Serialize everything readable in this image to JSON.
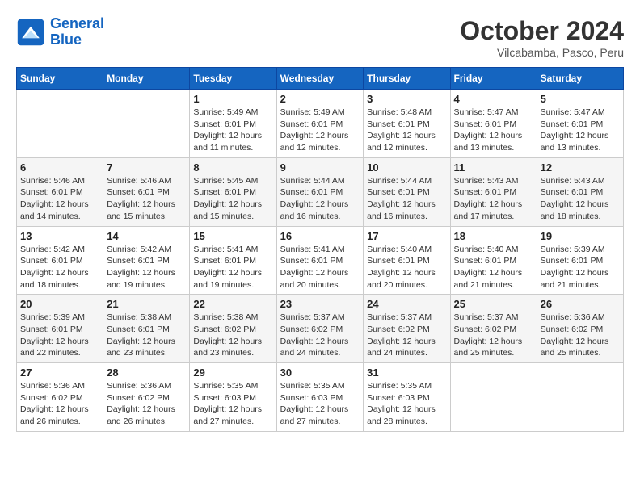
{
  "logo": {
    "line1": "General",
    "line2": "Blue"
  },
  "title": "October 2024",
  "subtitle": "Vilcabamba, Pasco, Peru",
  "weekdays": [
    "Sunday",
    "Monday",
    "Tuesday",
    "Wednesday",
    "Thursday",
    "Friday",
    "Saturday"
  ],
  "weeks": [
    [
      {
        "day": "",
        "info": ""
      },
      {
        "day": "",
        "info": ""
      },
      {
        "day": "1",
        "info": "Sunrise: 5:49 AM\nSunset: 6:01 PM\nDaylight: 12 hours\nand 11 minutes."
      },
      {
        "day": "2",
        "info": "Sunrise: 5:49 AM\nSunset: 6:01 PM\nDaylight: 12 hours\nand 12 minutes."
      },
      {
        "day": "3",
        "info": "Sunrise: 5:48 AM\nSunset: 6:01 PM\nDaylight: 12 hours\nand 12 minutes."
      },
      {
        "day": "4",
        "info": "Sunrise: 5:47 AM\nSunset: 6:01 PM\nDaylight: 12 hours\nand 13 minutes."
      },
      {
        "day": "5",
        "info": "Sunrise: 5:47 AM\nSunset: 6:01 PM\nDaylight: 12 hours\nand 13 minutes."
      }
    ],
    [
      {
        "day": "6",
        "info": "Sunrise: 5:46 AM\nSunset: 6:01 PM\nDaylight: 12 hours\nand 14 minutes."
      },
      {
        "day": "7",
        "info": "Sunrise: 5:46 AM\nSunset: 6:01 PM\nDaylight: 12 hours\nand 15 minutes."
      },
      {
        "day": "8",
        "info": "Sunrise: 5:45 AM\nSunset: 6:01 PM\nDaylight: 12 hours\nand 15 minutes."
      },
      {
        "day": "9",
        "info": "Sunrise: 5:44 AM\nSunset: 6:01 PM\nDaylight: 12 hours\nand 16 minutes."
      },
      {
        "day": "10",
        "info": "Sunrise: 5:44 AM\nSunset: 6:01 PM\nDaylight: 12 hours\nand 16 minutes."
      },
      {
        "day": "11",
        "info": "Sunrise: 5:43 AM\nSunset: 6:01 PM\nDaylight: 12 hours\nand 17 minutes."
      },
      {
        "day": "12",
        "info": "Sunrise: 5:43 AM\nSunset: 6:01 PM\nDaylight: 12 hours\nand 18 minutes."
      }
    ],
    [
      {
        "day": "13",
        "info": "Sunrise: 5:42 AM\nSunset: 6:01 PM\nDaylight: 12 hours\nand 18 minutes."
      },
      {
        "day": "14",
        "info": "Sunrise: 5:42 AM\nSunset: 6:01 PM\nDaylight: 12 hours\nand 19 minutes."
      },
      {
        "day": "15",
        "info": "Sunrise: 5:41 AM\nSunset: 6:01 PM\nDaylight: 12 hours\nand 19 minutes."
      },
      {
        "day": "16",
        "info": "Sunrise: 5:41 AM\nSunset: 6:01 PM\nDaylight: 12 hours\nand 20 minutes."
      },
      {
        "day": "17",
        "info": "Sunrise: 5:40 AM\nSunset: 6:01 PM\nDaylight: 12 hours\nand 20 minutes."
      },
      {
        "day": "18",
        "info": "Sunrise: 5:40 AM\nSunset: 6:01 PM\nDaylight: 12 hours\nand 21 minutes."
      },
      {
        "day": "19",
        "info": "Sunrise: 5:39 AM\nSunset: 6:01 PM\nDaylight: 12 hours\nand 21 minutes."
      }
    ],
    [
      {
        "day": "20",
        "info": "Sunrise: 5:39 AM\nSunset: 6:01 PM\nDaylight: 12 hours\nand 22 minutes."
      },
      {
        "day": "21",
        "info": "Sunrise: 5:38 AM\nSunset: 6:01 PM\nDaylight: 12 hours\nand 23 minutes."
      },
      {
        "day": "22",
        "info": "Sunrise: 5:38 AM\nSunset: 6:02 PM\nDaylight: 12 hours\nand 23 minutes."
      },
      {
        "day": "23",
        "info": "Sunrise: 5:37 AM\nSunset: 6:02 PM\nDaylight: 12 hours\nand 24 minutes."
      },
      {
        "day": "24",
        "info": "Sunrise: 5:37 AM\nSunset: 6:02 PM\nDaylight: 12 hours\nand 24 minutes."
      },
      {
        "day": "25",
        "info": "Sunrise: 5:37 AM\nSunset: 6:02 PM\nDaylight: 12 hours\nand 25 minutes."
      },
      {
        "day": "26",
        "info": "Sunrise: 5:36 AM\nSunset: 6:02 PM\nDaylight: 12 hours\nand 25 minutes."
      }
    ],
    [
      {
        "day": "27",
        "info": "Sunrise: 5:36 AM\nSunset: 6:02 PM\nDaylight: 12 hours\nand 26 minutes."
      },
      {
        "day": "28",
        "info": "Sunrise: 5:36 AM\nSunset: 6:02 PM\nDaylight: 12 hours\nand 26 minutes."
      },
      {
        "day": "29",
        "info": "Sunrise: 5:35 AM\nSunset: 6:03 PM\nDaylight: 12 hours\nand 27 minutes."
      },
      {
        "day": "30",
        "info": "Sunrise: 5:35 AM\nSunset: 6:03 PM\nDaylight: 12 hours\nand 27 minutes."
      },
      {
        "day": "31",
        "info": "Sunrise: 5:35 AM\nSunset: 6:03 PM\nDaylight: 12 hours\nand 28 minutes."
      },
      {
        "day": "",
        "info": ""
      },
      {
        "day": "",
        "info": ""
      }
    ]
  ]
}
